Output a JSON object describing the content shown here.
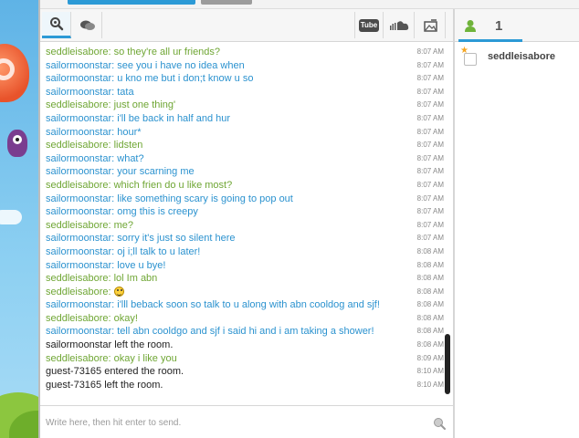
{
  "toolbar": {
    "icons": [
      "search-icon",
      "chat-bubbles-icon",
      "youtube-icon",
      "soundcloud-icon",
      "image-icon"
    ],
    "youtube_label": "Tube"
  },
  "messages": [
    {
      "text": "seddleisabore: so they're all ur friends?",
      "time": "8:07 AM",
      "color": "green"
    },
    {
      "text": "sailormoonstar: see you i have no idea when",
      "time": "8:07 AM",
      "color": "blue"
    },
    {
      "text": "sailormoonstar: u kno me but i don;t know u so",
      "time": "8:07 AM",
      "color": "blue"
    },
    {
      "text": "sailormoonstar: tata",
      "time": "8:07 AM",
      "color": "blue"
    },
    {
      "text": "seddleisabore: just one thing'",
      "time": "8:07 AM",
      "color": "green"
    },
    {
      "text": "sailormoonstar: i'll be back in half and hur",
      "time": "8:07 AM",
      "color": "blue"
    },
    {
      "text": "sailormoonstar: hour*",
      "time": "8:07 AM",
      "color": "blue"
    },
    {
      "text": "seddleisabore: lidsten",
      "time": "8:07 AM",
      "color": "green"
    },
    {
      "text": "sailormoonstar: what?",
      "time": "8:07 AM",
      "color": "blue"
    },
    {
      "text": "sailormoonstar: your scarning me",
      "time": "8:07 AM",
      "color": "blue"
    },
    {
      "text": "seddleisabore: which frien do u like most?",
      "time": "8:07 AM",
      "color": "green"
    },
    {
      "text": "sailormoonstar: like something scary is going to pop out",
      "time": "8:07 AM",
      "color": "blue"
    },
    {
      "text": "sailormoonstar: omg this is creepy",
      "time": "8:07 AM",
      "color": "blue"
    },
    {
      "text": "seddleisabore: me?",
      "time": "8:07 AM",
      "color": "green"
    },
    {
      "text": "sailormoonstar: sorry it's just so silent here",
      "time": "8:07 AM",
      "color": "blue"
    },
    {
      "text": "sailormoonstar: oj i;ll talk to u later!",
      "time": "8:08 AM",
      "color": "blue"
    },
    {
      "text": "sailormoonstar: love u bye!",
      "time": "8:08 AM",
      "color": "blue"
    },
    {
      "text": "seddleisabore: lol Im abn",
      "time": "8:08 AM",
      "color": "green"
    },
    {
      "text": "seddleisabore: ",
      "time": "8:08 AM",
      "color": "green",
      "smiley": true
    },
    {
      "text": "sailormoonstar: i'lll beback soon so talk to u along with abn cooldog and sjf!",
      "time": "8:08 AM",
      "color": "blue"
    },
    {
      "text": "seddleisabore: okay!",
      "time": "8:08 AM",
      "color": "green"
    },
    {
      "text": "sailormoonstar: tell abn cooldgo and sjf i said hi and i am taking a shower!",
      "time": "8:08 AM",
      "color": "blue"
    },
    {
      "text": "sailormoonstar left the room.",
      "time": "8:08 AM",
      "color": "black"
    },
    {
      "text": "seddleisabore: okay i like you",
      "time": "8:09 AM",
      "color": "green"
    },
    {
      "text": "guest-73165 entered the room.",
      "time": "8:10 AM",
      "color": "black"
    },
    {
      "text": "guest-73165 left the room.",
      "time": "8:10 AM",
      "color": "black"
    }
  ],
  "input": {
    "placeholder": "Write here, then hit enter to send.",
    "value": ""
  },
  "users": {
    "count": "1",
    "list": [
      {
        "name": "seddleisabore",
        "starred": true
      }
    ]
  },
  "colors": {
    "accent": "#2c9ad6",
    "green_user": "#6fa634",
    "blue_user": "#2b92cf",
    "system": "#222222"
  }
}
